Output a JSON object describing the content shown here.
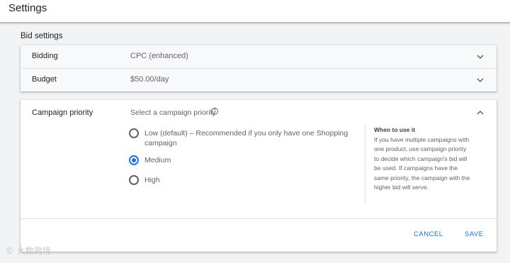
{
  "header": {
    "title": "Settings"
  },
  "bid_settings": {
    "section_title": "Bid settings",
    "rows": [
      {
        "label": "Bidding",
        "value": "CPC (enhanced)"
      },
      {
        "label": "Budget",
        "value": "$50.00/day"
      }
    ]
  },
  "campaign_priority": {
    "label": "Campaign priority",
    "prompt": "Select a campaign priority",
    "help_icon": "help-circle-icon",
    "options": [
      {
        "label": "Low (default) – Recommended if you only have one Shopping campaign",
        "selected": false
      },
      {
        "label": "Medium",
        "selected": true
      },
      {
        "label": "High",
        "selected": false
      }
    ],
    "help_panel": {
      "title": "When to use it",
      "body": "If you have multiple campaigns with one product, use campaign priority to decide which campaign's bid will be used. If campaigns have the same priority, the campaign with the higher bid will serve."
    },
    "cancel_label": "CANCEL",
    "save_label": "SAVE"
  },
  "watermark": "© 大数跨境",
  "colors": {
    "accent": "#1a73e8",
    "background": "#f1f3f4",
    "card": "#ffffff"
  }
}
